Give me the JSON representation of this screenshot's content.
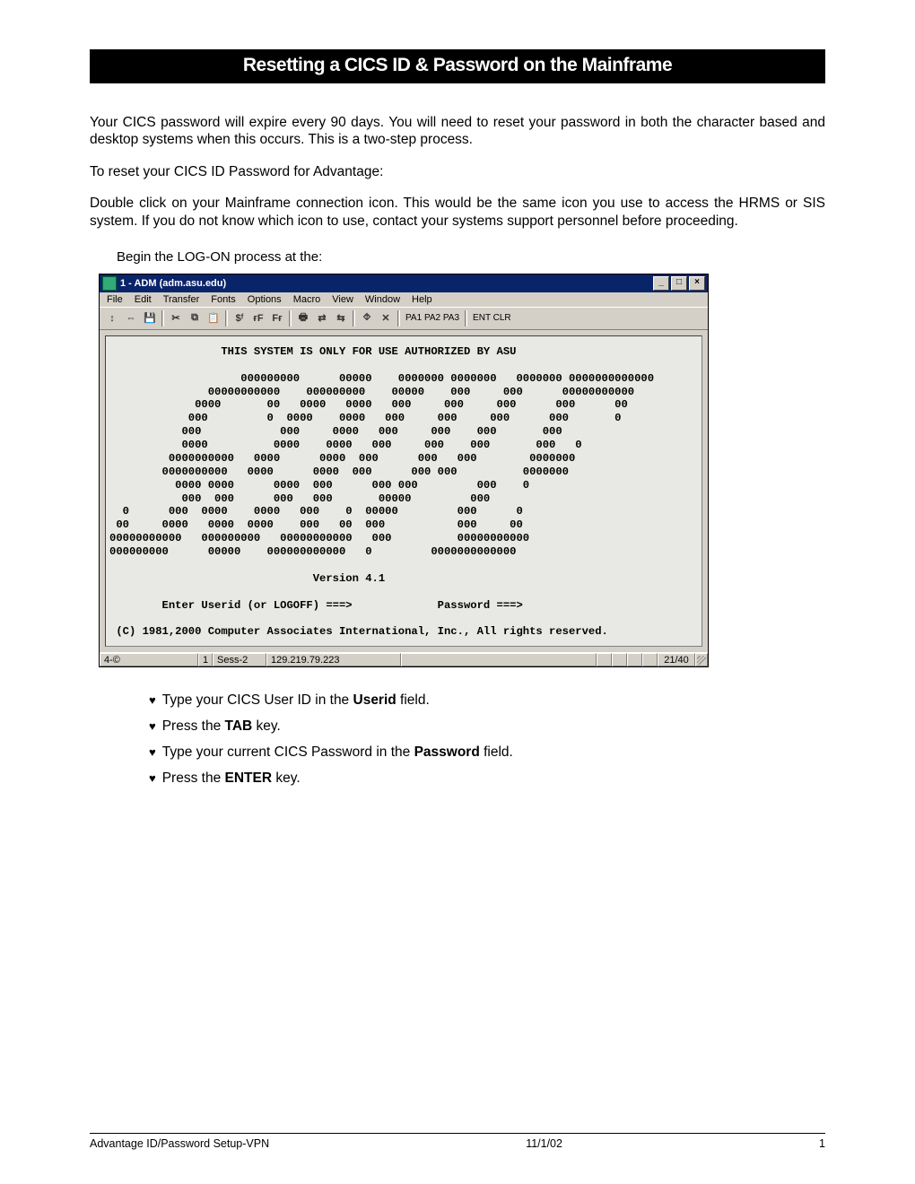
{
  "title": "Resetting a CICS ID & Password on the Mainframe",
  "intro_para1": "Your CICS password will expire every 90 days.  You will need to reset your password in both the character based and desktop systems when this occurs.  This is a two-step process.",
  "intro_para2": "To reset your CICS ID Password for Advantage:",
  "intro_para3": "Double click on your Mainframe connection icon.  This would be the same icon you use to access the HRMS or SIS system.  If you do not know which icon to use, contact your systems support personnel before proceeding.",
  "begin_logon": "Begin the LOG-ON process at the:",
  "window": {
    "title": "1 - ADM (adm.asu.edu)",
    "menus": [
      "File",
      "Edit",
      "Transfer",
      "Fonts",
      "Options",
      "Macro",
      "View",
      "Window",
      "Help"
    ],
    "toolbar_keys": [
      "PA1 PA2 PA3",
      "ENT CLR"
    ],
    "terminal_header": "THIS SYSTEM IS ONLY FOR USE AUTHORIZED BY ASU",
    "ascii_art": [
      "                    000000000      00000    0000000 0000000   0000000 0000000000000",
      "               00000000000    000000000    00000    000     000      00000000000",
      "             0000       00   0000   0000   000     000     000      000      00",
      "            000         0  0000    0000   000     000     000      000       0",
      "           000            000     0000   000     000    000       000",
      "           0000          0000    0000   000     000    000       000   0",
      "         0000000000   0000      0000  000      000   000        0000000",
      "        0000000000   0000      0000  000      000 000          0000000",
      "          0000 0000      0000  000      000 000         000    0",
      "           000  000      000   000       00000         000",
      "  0      000  0000    0000   000    0  00000         000      0",
      " 00     0000   0000  0000    000   00  000           000     00",
      "00000000000   000000000   00000000000   000          00000000000",
      "000000000      00000    000000000000   0         0000000000000"
    ],
    "version": "Version 4.1",
    "prompt_userid": "Enter Userid (or LOGOFF) ===>",
    "prompt_password": "Password ===>",
    "copyright": "(C) 1981,2000 Computer Associates International, Inc., All rights reserved.",
    "status": {
      "left": "4-©",
      "sess_num": "1",
      "sess_label": "Sess-2",
      "ip": "129.219.79.223",
      "pos": "21/40"
    }
  },
  "bullets": [
    {
      "pre": "Type your CICS User ID in the ",
      "bold": "Userid",
      "post": " field."
    },
    {
      "pre": "Press the ",
      "bold": "TAB",
      "post": " key."
    },
    {
      "pre": "Type your current CICS Password in the ",
      "bold": "Password",
      "post": " field."
    },
    {
      "pre": "Press the ",
      "bold": "ENTER",
      "post": " key."
    }
  ],
  "footer": {
    "left": "Advantage ID/Password Setup-VPN",
    "center": "11/1/02",
    "right": "1"
  }
}
